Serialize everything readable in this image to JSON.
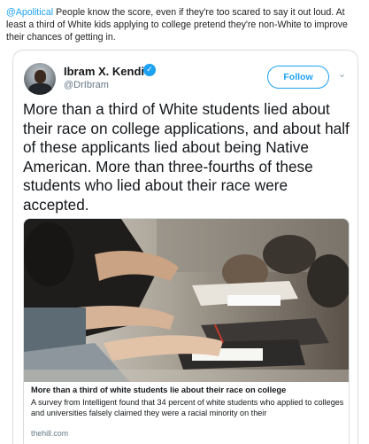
{
  "caption": {
    "mention": "@Apolitical",
    "text": " People know the score, even if they're too scared to say it out loud. At least a third of White kids applying to college pretend they're non-White to improve their chances of getting in."
  },
  "tweet": {
    "author_name": "Ibram X. Kendi",
    "handle": "@DrIbram",
    "verified_glyph": "✓",
    "follow_label": "Follow",
    "chevron_glyph": "⌄",
    "text": "More than a third of White students lied about their race on college applications, and about half of these applicants lied about being Native American. More than three-fourths of these students who lied about their race were accepted."
  },
  "card": {
    "title": "More than a third of white students lie about their race on college",
    "description": "A survey from Intelligent found that 34 percent of white students who applied to colleges and universities falsely claimed they were a racial minority on their",
    "domain": "thehill.com"
  },
  "colors": {
    "accent": "#1da1f2",
    "text": "#14171a",
    "muted": "#657786",
    "border": "#d9dde0"
  }
}
